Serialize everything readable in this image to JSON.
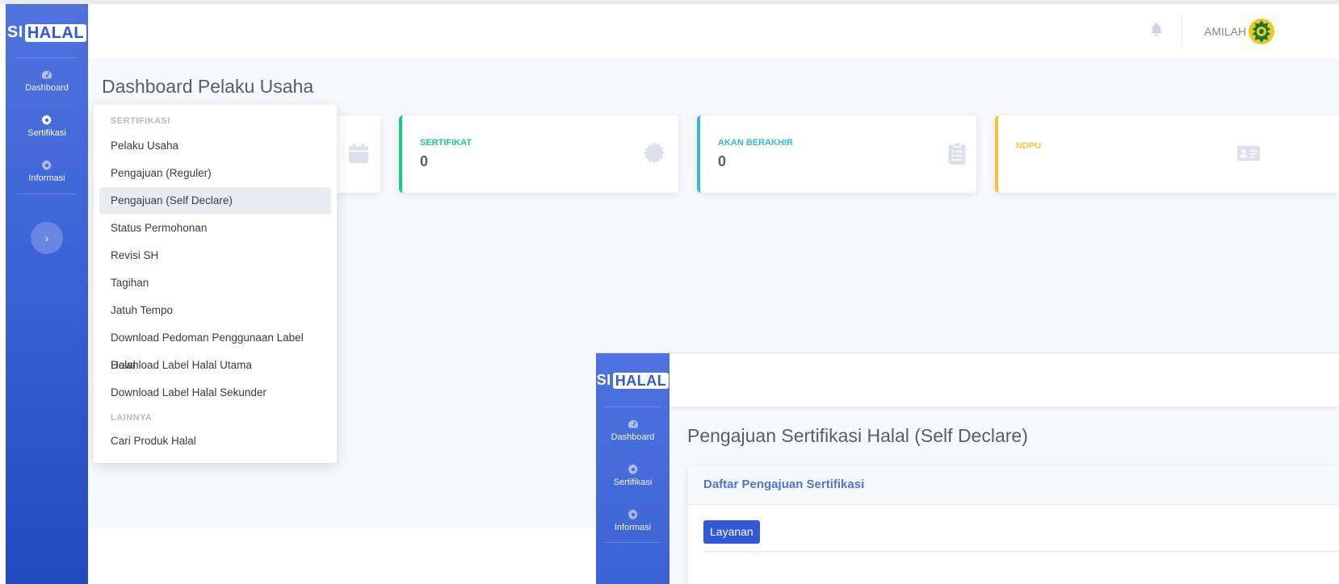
{
  "brand": {
    "prefix": "SI",
    "boxed": "HALAL"
  },
  "sidebar": {
    "items": [
      {
        "label": "Dashboard"
      },
      {
        "label": "Sertifikasi"
      },
      {
        "label": "Informasi"
      }
    ],
    "toggle_glyph": "›"
  },
  "topbar": {
    "username": "AMILAH"
  },
  "page": {
    "title": "Dashboard Pelaku Usaha"
  },
  "cards": [
    {
      "label": "SERTIFIKAT",
      "value": "0",
      "color": "#1cc88a",
      "icon": "certificate-icon"
    },
    {
      "label": "AKAN BERAKHIR",
      "value": "0",
      "color": "#36b9cc",
      "icon": "clipboard-list-icon"
    },
    {
      "label": "NDPU",
      "value": "",
      "color": "#f6c23e",
      "icon": "id-card-icon"
    }
  ],
  "dropdown": {
    "header_sertifikasi": "SERTIFIKASI",
    "items": [
      "Pelaku Usaha",
      "Pengajuan (Reguler)",
      "Pengajuan (Self Declare)",
      "Status Permohonan",
      "Revisi SH",
      "Tagihan",
      "Jatuh Tempo",
      "Download Pedoman Penggunaan Label Halal",
      "Download Label Halal Utama",
      "Download Label Halal Sekunder"
    ],
    "active_item": "Pengajuan (Self Declare)",
    "header_lainnya": "LAINNYA",
    "lainnya_items": [
      "Cari Produk Halal"
    ]
  },
  "overlay": {
    "brand": {
      "prefix": "SI",
      "boxed": "HALAL"
    },
    "sidebar_items": [
      {
        "label": "Dashboard"
      },
      {
        "label": "Sertifikasi"
      },
      {
        "label": "Informasi"
      }
    ],
    "page_title": "Pengajuan Sertifikasi Halal (Self Declare)",
    "card_title": "Daftar Pengajuan Sertifikasi",
    "button_label": "Layanan"
  },
  "colors": {
    "primary": "#4e73df",
    "primary_dark": "#224abe",
    "success": "#1cc88a",
    "info": "#36b9cc",
    "warning": "#f6c23e",
    "text_gray": "#5a5c69",
    "dropdown_header": "#b7b9cc"
  }
}
